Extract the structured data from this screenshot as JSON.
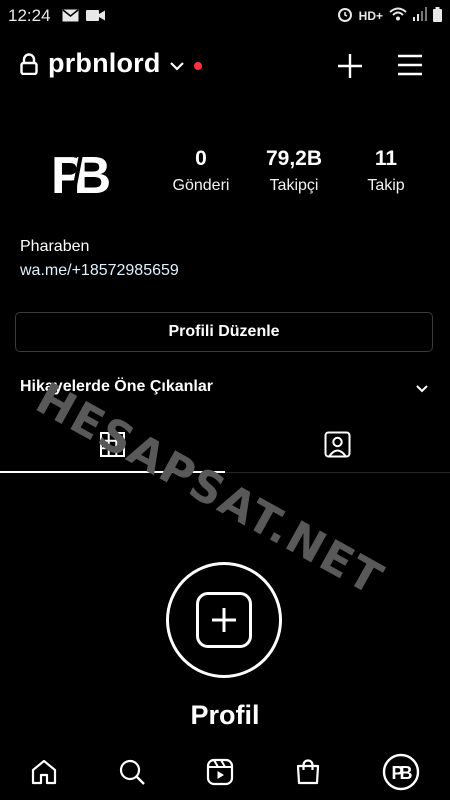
{
  "status_bar": {
    "time": "12:24",
    "network": "HD+"
  },
  "header": {
    "username": "prbnlord"
  },
  "profile": {
    "avatar_text": "PB"
  },
  "stats": [
    {
      "value": "0",
      "label": "Gönderi"
    },
    {
      "value": "79,2B",
      "label": "Takipçi"
    },
    {
      "value": "11",
      "label": "Takip"
    }
  ],
  "bio": {
    "name": "Pharaben",
    "link": "wa.me/+18572985659"
  },
  "buttons": {
    "edit_profile": "Profili Düzenle"
  },
  "highlights": {
    "label": "Hikayelerde Öne Çıkanlar"
  },
  "empty_state": {
    "title": "Profil"
  },
  "watermark": {
    "text": "HESAPSAT.NET"
  },
  "colors": {
    "background": "#000000",
    "notification_dot": "#ff3040"
  },
  "icons": {
    "header": [
      "lock-icon",
      "chevron-down-icon",
      "add-icon",
      "menu-icon"
    ],
    "tabs": [
      "grid-icon",
      "tagged-icon"
    ],
    "nav": [
      "home-icon",
      "search-icon",
      "reels-icon",
      "shop-icon",
      "profile-avatar-icon"
    ]
  }
}
